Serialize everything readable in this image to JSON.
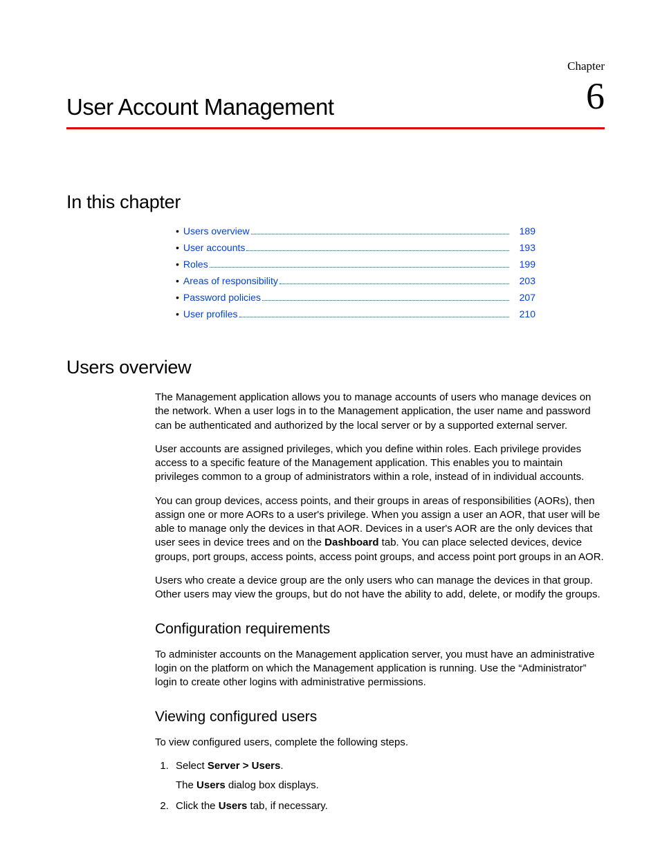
{
  "chapter": {
    "label": "Chapter",
    "number": "6",
    "title": "User Account Management"
  },
  "sections": {
    "in_this_chapter": "In this chapter",
    "users_overview": "Users overview"
  },
  "toc": [
    {
      "label": "Users overview",
      "page": "189"
    },
    {
      "label": "User accounts",
      "page": "193"
    },
    {
      "label": "Roles",
      "page": "199"
    },
    {
      "label": "Areas of responsibility",
      "page": "203"
    },
    {
      "label": "Password policies",
      "page": "207"
    },
    {
      "label": "User profiles",
      "page": "210"
    }
  ],
  "overview": {
    "p1": "The Management application allows you to manage accounts of users who manage devices on the network. When a user logs in to the Management application, the user name and password can be authenticated and authorized by the local server or by a supported external server.",
    "p2": "User accounts are assigned privileges, which you define within roles. Each privilege provides access to a specific feature of the Management application. This enables you to maintain privileges common to a group of administrators within a role, instead of in individual accounts.",
    "p3a": "You can group devices, access points, and their groups in areas of responsibilities (AORs), then assign one or more AORs to a user's privilege. When you assign a user an AOR, that user will be able to manage only the devices in that AOR. Devices in a user's AOR are the only devices that user sees in device trees and on the ",
    "p3_bold": "Dashboard",
    "p3b": " tab. You can place selected devices, device groups, port groups, access points, access point groups, and access point port groups in an AOR.",
    "p4": "Users who create a device group are the only users who can manage the devices in that group. Other users may view the groups, but do not have the ability to add, delete, or modify the groups."
  },
  "config_req": {
    "heading": "Configuration requirements",
    "p1": "To administer accounts on the Management application server, you must have an administrative login on the platform on which the Management application is running. Use the “Administrator” login to create other logins with administrative permissions."
  },
  "viewing": {
    "heading": "Viewing configured users",
    "intro": "To view configured users, complete the following steps.",
    "step1_a": "Select ",
    "step1_bold": "Server > Users",
    "step1_b": ".",
    "step1_sub_a": "The ",
    "step1_sub_bold": "Users",
    "step1_sub_b": " dialog box displays.",
    "step2_a": "Click the ",
    "step2_bold": "Users",
    "step2_b": " tab, if necessary."
  }
}
